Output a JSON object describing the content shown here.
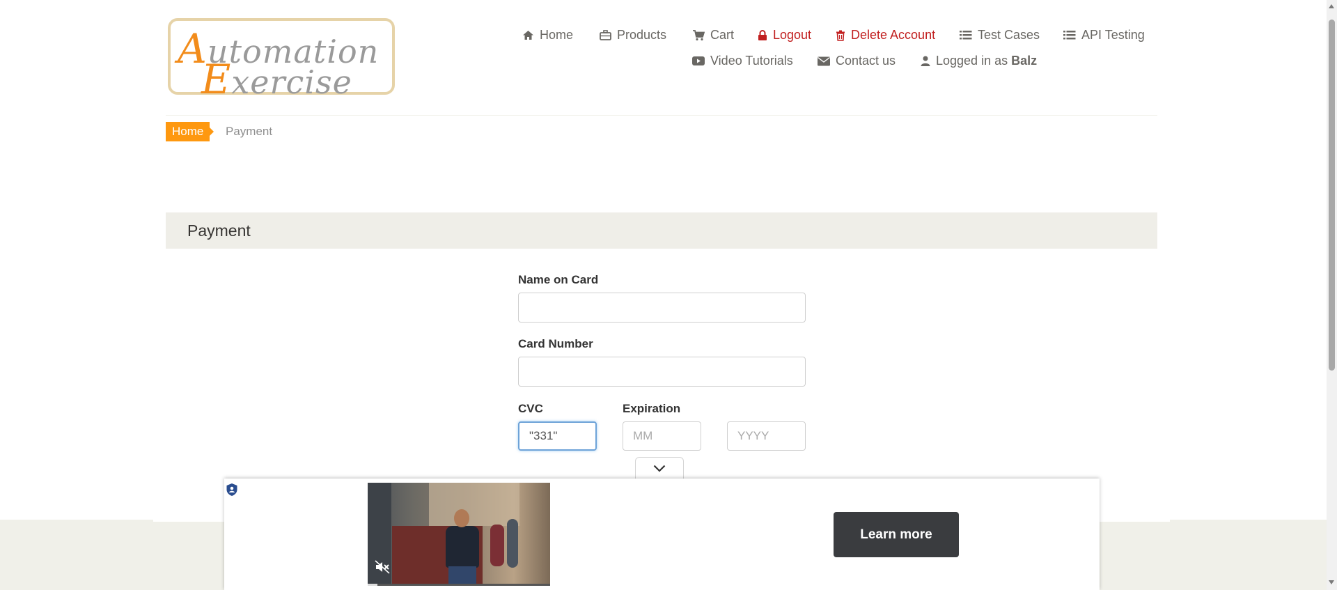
{
  "logo": {
    "line1_cap": "A",
    "line1_rest": "utomation",
    "line2_cap": "E",
    "line2_rest": "xercise"
  },
  "nav": {
    "home": "Home",
    "products": "Products",
    "cart": "Cart",
    "logout": "Logout",
    "delete_account": "Delete Account",
    "test_cases": "Test Cases",
    "api_testing": "API Testing",
    "video_tutorials": "Video Tutorials",
    "contact_us": "Contact us",
    "logged_in_prefix": "Logged in as",
    "username": "Balz"
  },
  "breadcrumb": {
    "home": "Home",
    "current": "Payment"
  },
  "heading": "Payment",
  "form": {
    "name_label": "Name on Card",
    "name_value": "",
    "card_label": "Card Number",
    "card_value": "",
    "cvc_label": "CVC",
    "cvc_value": "\"331\"",
    "expiration_label": "Expiration",
    "month_placeholder": "MM",
    "year_placeholder": "YYYY"
  },
  "ad": {
    "cta_label": "Learn more"
  },
  "colors": {
    "accent": "#fe980f",
    "danger": "#c11f1f",
    "panel": "#efeee8"
  }
}
